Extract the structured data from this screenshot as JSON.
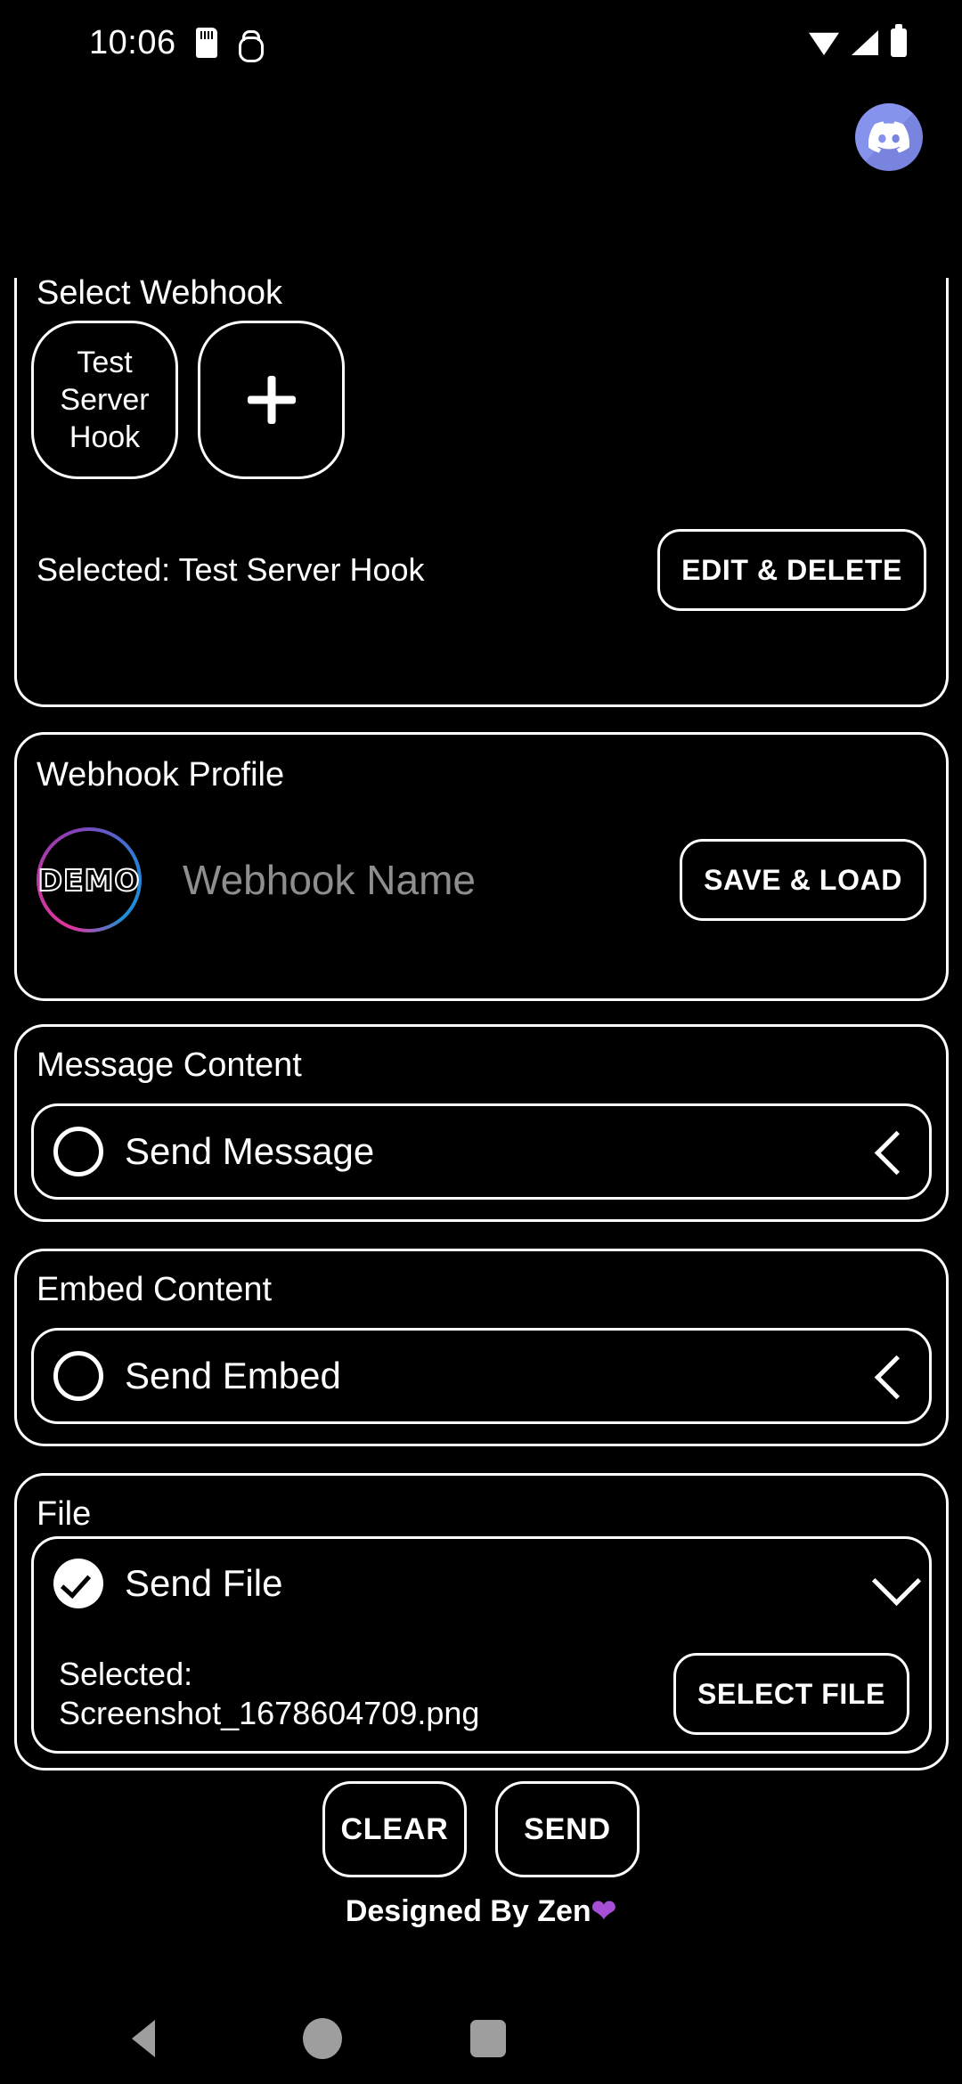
{
  "status_bar": {
    "time": "10:06",
    "icons": [
      "sd-card-icon",
      "usb-debug-icon",
      "wifi-icon",
      "signal-icon",
      "battery-icon"
    ]
  },
  "app_bar": {
    "logo": "discord-icon",
    "logo_color": "#7f8ceb"
  },
  "select_webhook": {
    "label": "Select Webhook",
    "chips": [
      {
        "label": "Test Server Hook"
      }
    ],
    "add_chip_icon": "plus-icon",
    "selected_text": "Selected: Test Server Hook",
    "edit_delete_label": "EDIT & DELETE"
  },
  "webhook_profile": {
    "label": "Webhook Profile",
    "avatar_text": "DEMO",
    "avatar_ring_colors": [
      "#e0359c",
      "#8b3fb8",
      "#1f8fd6"
    ],
    "name_placeholder": "Webhook Name",
    "save_load_label": "SAVE & LOAD"
  },
  "message_content": {
    "label": "Message Content",
    "toggle_label": "Send Message",
    "checked": false,
    "chevron": "chevron-left-icon"
  },
  "embed_content": {
    "label": "Embed Content",
    "toggle_label": "Send Embed",
    "checked": false,
    "chevron": "chevron-left-icon"
  },
  "file_section": {
    "label": "File",
    "toggle_label": "Send File",
    "checked": true,
    "chevron": "chevron-down-icon",
    "selected_prefix": "Selected:",
    "selected_file": "Screenshot_1678604709.png",
    "select_file_label": "SELECT FILE"
  },
  "actions": {
    "clear_label": "CLEAR",
    "send_label": "SEND"
  },
  "footer": {
    "text": "Designed By Zen",
    "heart": "❤",
    "heart_color": "#a64fd6"
  },
  "nav_bar": {
    "back": "back-triangle-icon",
    "home": "home-circle-icon",
    "recents": "recents-square-icon",
    "color": "#9e9e9e"
  }
}
